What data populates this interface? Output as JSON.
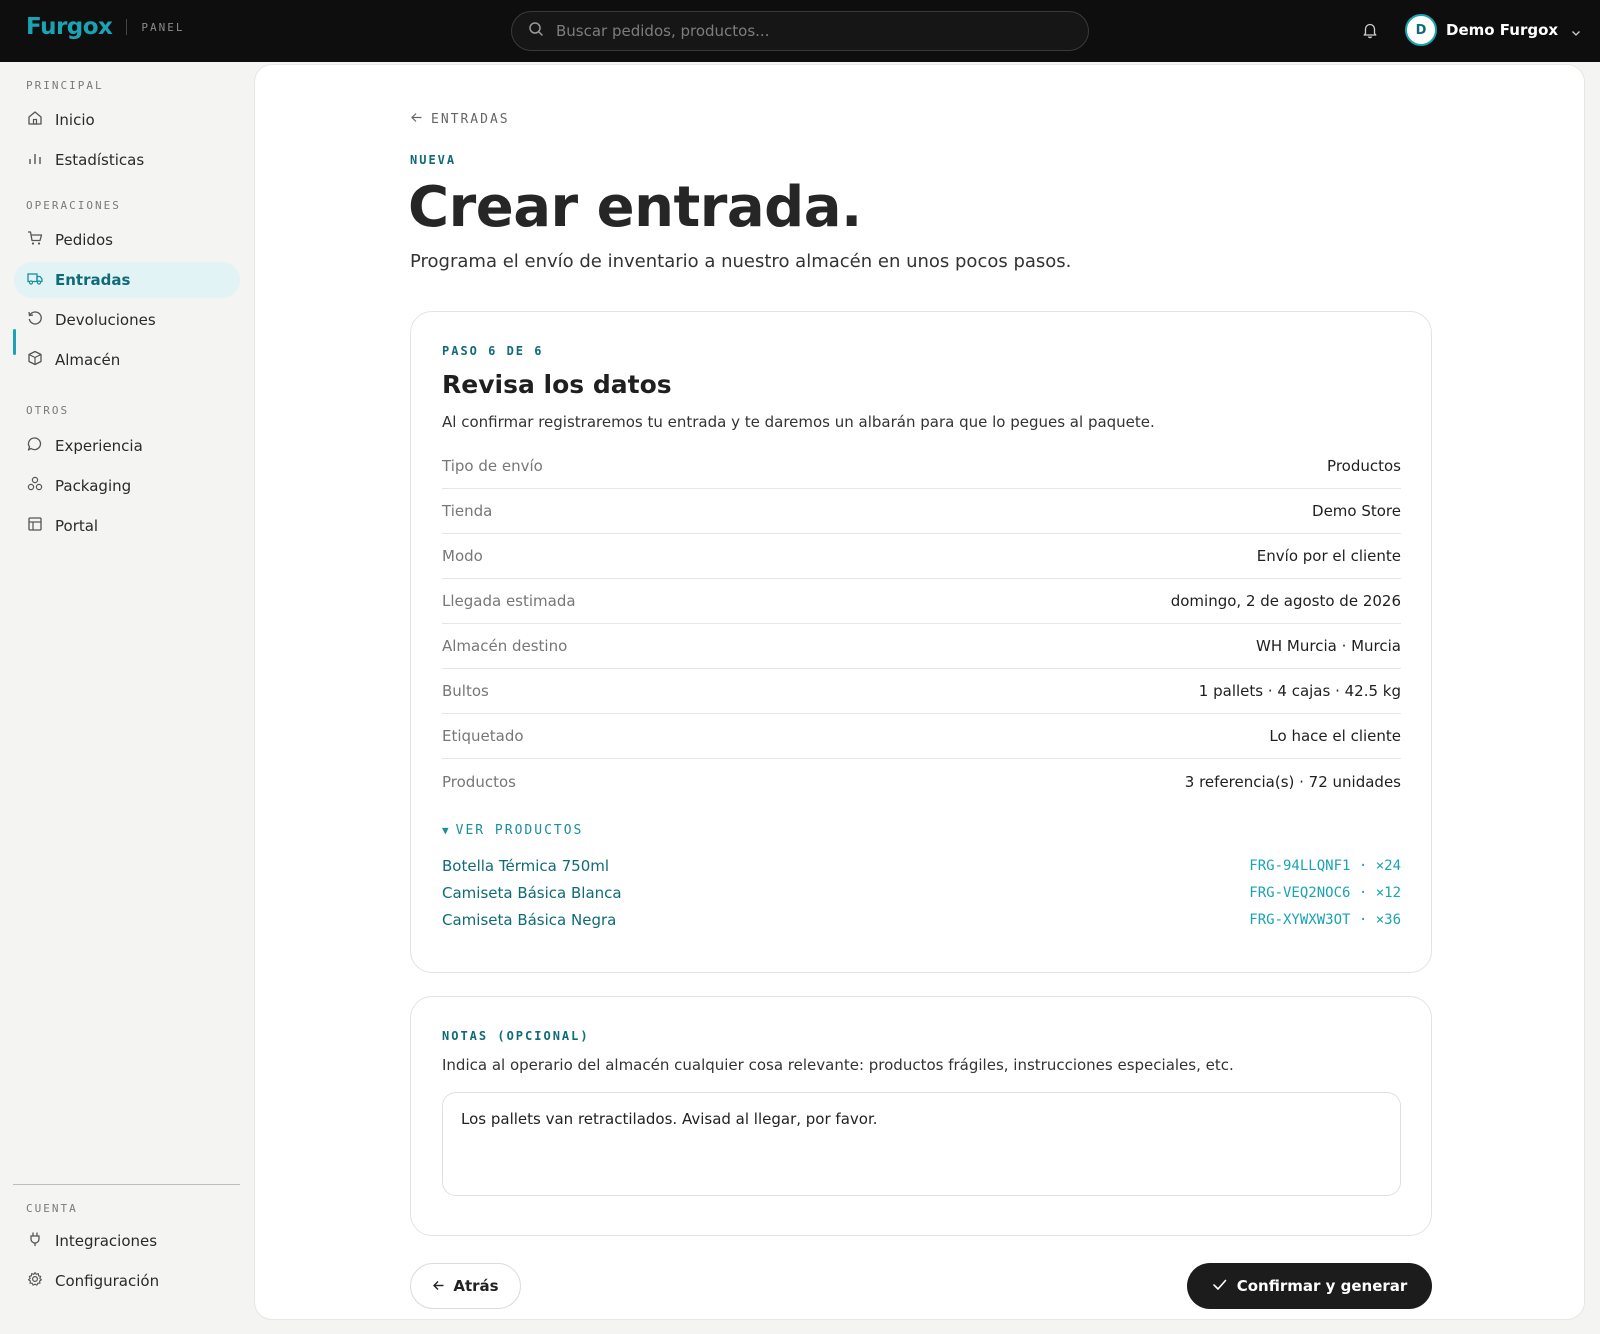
{
  "header": {
    "brand": "Furgox",
    "panel_label": "PANEL",
    "search_placeholder": "Buscar pedidos, productos...",
    "user_initial": "D",
    "user_name": "Demo Furgox",
    "accent_color": "#1aa3b3"
  },
  "sidebar": {
    "sections": [
      {
        "label": "PRINCIPAL",
        "items": [
          {
            "label": "Inicio",
            "icon": "home-icon"
          },
          {
            "label": "Estadísticas",
            "icon": "bar-chart-icon"
          }
        ]
      },
      {
        "label": "OPERACIONES",
        "items": [
          {
            "label": "Pedidos",
            "icon": "cart-icon"
          },
          {
            "label": "Entradas",
            "icon": "truck-icon",
            "active": true
          },
          {
            "label": "Devoluciones",
            "icon": "return-icon"
          },
          {
            "label": "Almacén",
            "icon": "box-icon"
          }
        ]
      },
      {
        "label": "OTROS",
        "items": [
          {
            "label": "Experiencia",
            "icon": "chat-icon"
          },
          {
            "label": "Packaging",
            "icon": "packages-icon"
          },
          {
            "label": "Portal",
            "icon": "layout-icon"
          }
        ]
      },
      {
        "label": "CUENTA",
        "items": [
          {
            "label": "Integraciones",
            "icon": "plug-icon"
          },
          {
            "label": "Configuración",
            "icon": "gear-icon"
          }
        ]
      }
    ]
  },
  "page": {
    "back_label": "ENTRADAS",
    "eyebrow": "NUEVA",
    "title": "Crear entrada.",
    "subtitle": "Programa el envío de inventario a nuestro almacén en unos pocos pasos."
  },
  "review": {
    "step": "PASO 6 DE 6",
    "title": "Revisa los datos",
    "description": "Al confirmar registraremos tu entrada y te daremos un albarán para que lo pegues al paquete.",
    "rows": [
      {
        "key": "Tipo de envío",
        "value": "Productos"
      },
      {
        "key": "Tienda",
        "value": "Demo Store"
      },
      {
        "key": "Modo",
        "value": "Envío por el cliente"
      },
      {
        "key": "Llegada estimada",
        "value": "domingo, 2 de agosto de 2026"
      },
      {
        "key": "Almacén destino",
        "value": "WH Murcia · Murcia"
      },
      {
        "key": "Bultos",
        "value": "1 pallets · 4 cajas · 42.5 kg"
      },
      {
        "key": "Etiquetado",
        "value": "Lo hace el cliente"
      },
      {
        "key": "Productos",
        "value": "3 referencia(s) · 72 unidades"
      }
    ],
    "toggle_label": "VER PRODUCTOS",
    "toggle_glyph": "▼",
    "products": [
      {
        "name": "Botella Térmica 750ml",
        "meta": "FRG-94LLQNF1 · ×24"
      },
      {
        "name": "Camiseta Básica Blanca",
        "meta": "FRG-VEQ2NOC6 · ×12"
      },
      {
        "name": "Camiseta Básica Negra",
        "meta": "FRG-XYWXW3OT · ×36"
      }
    ]
  },
  "notes": {
    "label": "NOTAS (OPCIONAL)",
    "description": "Indica al operario del almacén cualquier cosa relevante: productos frágiles, instrucciones especiales, etc.",
    "value": "Los pallets van retractilados. Avisad al llegar, por favor."
  },
  "actions": {
    "back_label": "Atrás",
    "confirm_label": "Confirmar y generar"
  }
}
